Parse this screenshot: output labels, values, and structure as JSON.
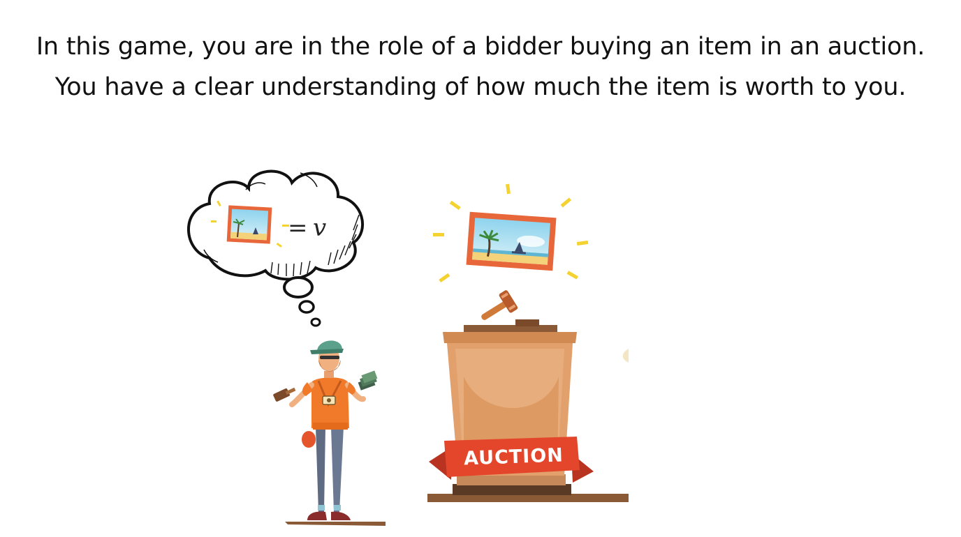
{
  "intro": {
    "line1": "In this game, you are in the role of a bidder buying an item in an auction.",
    "line2": "You have a clear understanding of how much the item is worth to you."
  },
  "thought_bubble": {
    "equals": "=",
    "variable": "v"
  },
  "podium": {
    "banner_text": "AUCTION"
  },
  "icons": [
    "thought-bubble-icon",
    "painting-icon",
    "gavel-icon",
    "bidder-figure",
    "podium-icon",
    "sparkle-icon"
  ],
  "colors": {
    "text": "#111111",
    "podium": "#e2a06c",
    "podium_dark": "#a86b3c",
    "banner": "#e4462c",
    "frame": "#e8673a",
    "sparkle": "#f4d22f",
    "shirt": "#f07a2a",
    "cap": "#5aa08a"
  }
}
